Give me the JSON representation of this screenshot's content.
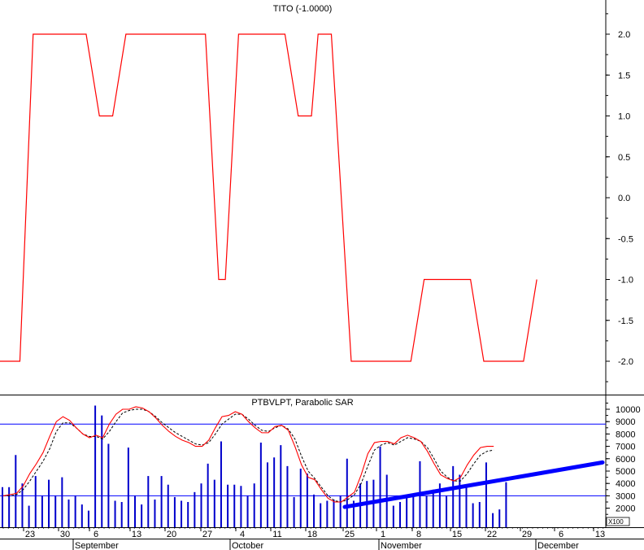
{
  "chart_data": [
    {
      "type": "line",
      "title": "TITO (-1.0000)",
      "ylim": [
        -2.35,
        2.35
      ],
      "yticks": [
        "2.0",
        "1.5",
        "1.0",
        "0.5",
        "0.0",
        "-0.5",
        "-1.0",
        "-1.5",
        "-2.0"
      ],
      "ytick_values": [
        2.0,
        1.5,
        1.0,
        0.5,
        0.0,
        -0.5,
        -1.0,
        -1.5,
        -2.0
      ],
      "line_color": "#ff0000",
      "series": [
        {
          "x": [
            0,
            3,
            5,
            13,
            15,
            17,
            19,
            31,
            33,
            34,
            36,
            43,
            45,
            47,
            48,
            50,
            53,
            62,
            64,
            71,
            73,
            79,
            81
          ],
          "values": [
            -2,
            -2,
            2,
            2,
            1,
            1,
            2,
            2,
            -1,
            -1,
            2,
            2,
            1,
            1,
            2,
            2,
            -2,
            -2,
            -1,
            -1,
            -2,
            -2,
            -1
          ]
        }
      ]
    },
    {
      "type": "line",
      "title": "PTBVLPT, Parabolic SAR",
      "ylim": [
        1500,
        10900
      ],
      "yticks": [
        "10000",
        "9000",
        "8000",
        "7000",
        "6000",
        "5000",
        "4000",
        "3000",
        "2000"
      ],
      "ytick_values": [
        10000,
        9000,
        8000,
        7000,
        6000,
        5000,
        4000,
        3000,
        2000
      ],
      "unit_label": "X100",
      "hlines": [
        8800,
        3000
      ],
      "colors": {
        "fast": "#ff0000",
        "slow": "#000000",
        "bars": "#0000cc",
        "trend": "#0000ff"
      },
      "bars": [
        3700,
        3700,
        6300,
        4000,
        2200,
        4600,
        3000,
        4300,
        3000,
        4500,
        2700,
        3000,
        2300,
        1800,
        10300,
        9500,
        7200,
        2600,
        2500,
        6900,
        3000,
        2300,
        4600,
        2700,
        4600,
        3900,
        2900,
        2600,
        2500,
        3300,
        4000,
        5600,
        4300,
        7400,
        3900,
        3900,
        3800,
        3000,
        4000,
        7300,
        5700,
        6100,
        7100,
        5400,
        2900,
        5200,
        4800,
        3100,
        2400,
        2600,
        2700,
        3000,
        6000,
        2600,
        4000,
        4200,
        4300,
        7000,
        4700,
        2200,
        2500,
        2900,
        3000,
        5800,
        3000,
        3500,
        4000,
        3000,
        5400,
        4700,
        3700,
        2400,
        2500,
        5700,
        1600,
        1900,
        4100
      ],
      "fast_line": [
        3000,
        3100,
        3200,
        3800,
        4800,
        5600,
        6500,
        7800,
        9000,
        9400,
        9100,
        8500,
        8000,
        7700,
        7900,
        7700,
        8800,
        9600,
        10000,
        10000,
        10200,
        10100,
        9800,
        9300,
        8700,
        8200,
        7800,
        7500,
        7300,
        7000,
        7000,
        7500,
        8500,
        9400,
        9500,
        9800,
        9600,
        9000,
        8500,
        8100,
        8100,
        8600,
        8700,
        8300,
        7000,
        5500,
        4500,
        4300,
        3500,
        2800,
        2500,
        2500,
        2900,
        3300,
        4700,
        6400,
        7300,
        7400,
        7400,
        7200,
        7700,
        7900,
        7700,
        7400,
        6600,
        5600,
        4700,
        4400,
        4200,
        4500,
        5500,
        6300,
        6900,
        7000,
        7000
      ],
      "slow_line": [
        3000,
        3000,
        3100,
        3500,
        4200,
        5000,
        5800,
        6800,
        8200,
        8900,
        8900,
        8500,
        8000,
        7800,
        7800,
        7600,
        8200,
        9000,
        9700,
        9900,
        10000,
        10000,
        9800,
        9400,
        8900,
        8500,
        8100,
        7800,
        7500,
        7200,
        7100,
        7300,
        8000,
        8800,
        9200,
        9600,
        9600,
        9200,
        8700,
        8300,
        8200,
        8500,
        8700,
        8400,
        7600,
        6200,
        5000,
        4400,
        3700,
        3000,
        2600,
        2500,
        2700,
        3100,
        4000,
        5400,
        6700,
        7100,
        7300,
        7100,
        7400,
        7700,
        7600,
        7400,
        6900,
        6000,
        5000,
        4500,
        4200,
        4200,
        4800,
        5600,
        6300,
        6600,
        6700
      ],
      "trendline": [
        [
          63,
          2100
        ],
        [
          90,
          5700
        ]
      ]
    }
  ],
  "x_axis": {
    "day_ticks": [
      "23",
      "30",
      "6",
      "13",
      "20",
      "27",
      "4",
      "11",
      "18",
      "25",
      "1",
      "8",
      "15",
      "22",
      "29",
      "6",
      "13"
    ],
    "month_labels": [
      "September",
      "October",
      "November",
      "December"
    ]
  }
}
